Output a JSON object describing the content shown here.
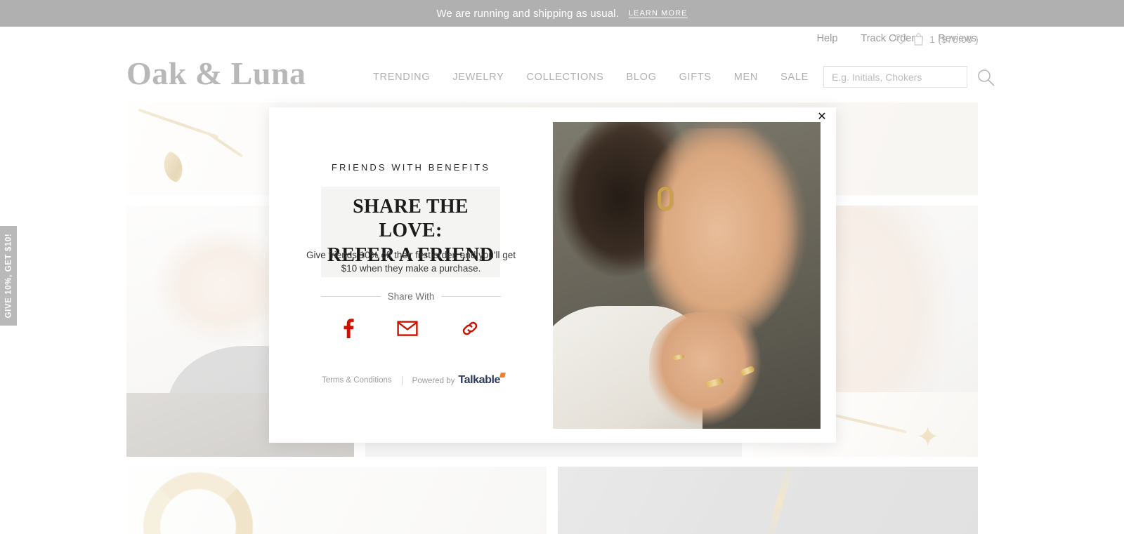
{
  "announcement": {
    "message": "We are running and shipping as usual.",
    "link_label": "LEARN MORE",
    "background": "#b0b0b0"
  },
  "utility_nav": {
    "links": [
      {
        "label": "Help"
      },
      {
        "label": "Track Order"
      },
      {
        "label": "Reviews"
      }
    ],
    "wishlist_icon": "heart-icon",
    "cart_icon": "shopping-bag-icon",
    "cart_summary": "1 ($75.00 )"
  },
  "header": {
    "logo": "Oak & Luna",
    "nav": [
      {
        "label": "TRENDING"
      },
      {
        "label": "JEWELRY"
      },
      {
        "label": "COLLECTIONS"
      },
      {
        "label": "BLOG"
      },
      {
        "label": "GIFTS"
      },
      {
        "label": "MEN"
      },
      {
        "label": "SALE"
      }
    ],
    "search": {
      "placeholder": "E.g. Initials, Chokers",
      "value": "",
      "icon": "search-icon"
    }
  },
  "side_tab": {
    "label": "GIVE 10%, GET $10!"
  },
  "modal": {
    "close_label": "✕",
    "eyebrow": "FRIENDS WITH BENEFITS",
    "headline_line1": "SHARE THE LOVE:",
    "headline_line2": "REFER A FRIEND",
    "subcopy": "Give friends 10% off their first order, and you'll get $10 when they make a purchase.",
    "share_with_label": "Share With",
    "share_buttons": [
      {
        "name": "facebook-icon",
        "label": "Facebook"
      },
      {
        "name": "email-icon",
        "label": "Email"
      },
      {
        "name": "link-icon",
        "label": "Copy Link"
      }
    ],
    "accent_color": "#cc1100",
    "terms_label": "Terms & Conditions",
    "powered_by_label": "Powered by",
    "powered_by_brand": "Talkable",
    "photo_alt": "Model wearing gold hoop earring and gold rings"
  },
  "background_grid": {
    "tiles": [
      {
        "name": "moon-charm-bracelet"
      },
      {
        "name": "model-portrait-necklace"
      },
      {
        "name": "layered-necklaces-rings"
      },
      {
        "name": "star-charm-bracelet"
      },
      {
        "name": "gold-signet-ring"
      },
      {
        "name": "gold-chain-gray"
      }
    ]
  }
}
